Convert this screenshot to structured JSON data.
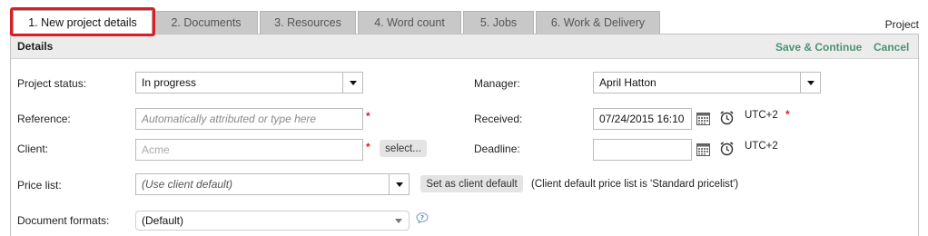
{
  "tabs": [
    {
      "label": "1. New project details",
      "active": true
    },
    {
      "label": "2. Documents"
    },
    {
      "label": "3. Resources"
    },
    {
      "label": "4. Word count"
    },
    {
      "label": "5. Jobs"
    },
    {
      "label": "6. Work & Delivery"
    }
  ],
  "header": {
    "project_label": "Project",
    "section_title": "Details",
    "save_continue": "Save & Continue",
    "cancel": "Cancel"
  },
  "form": {
    "project_status": {
      "label": "Project status:",
      "value": "In progress"
    },
    "reference": {
      "label": "Reference:",
      "placeholder": "Automatically attributed or type here",
      "required": "*"
    },
    "client": {
      "label": "Client:",
      "placeholder": "Acme",
      "required": "*",
      "select_button": "select..."
    },
    "price_list": {
      "label": "Price list:",
      "value": "(Use client default)",
      "set_default_button": "Set as client default",
      "note": "(Client default price list is 'Standard pricelist')"
    },
    "document_formats": {
      "label": "Document formats:",
      "value": "(Default)"
    },
    "manager": {
      "label": "Manager:",
      "value": "April Hatton"
    },
    "received": {
      "label": "Received:",
      "value": "07/24/2015 16:10",
      "timezone": "UTC+2",
      "required": "*"
    },
    "deadline": {
      "label": "Deadline:",
      "value": "",
      "timezone": "UTC+2"
    }
  },
  "colors": {
    "accent_green": "#4e9272",
    "highlight_red": "#e01b22",
    "required_red": "#e01b22"
  },
  "icons": [
    "calendar-icon",
    "alarm-clock-icon",
    "help-icon",
    "chevron-down-icon"
  ]
}
